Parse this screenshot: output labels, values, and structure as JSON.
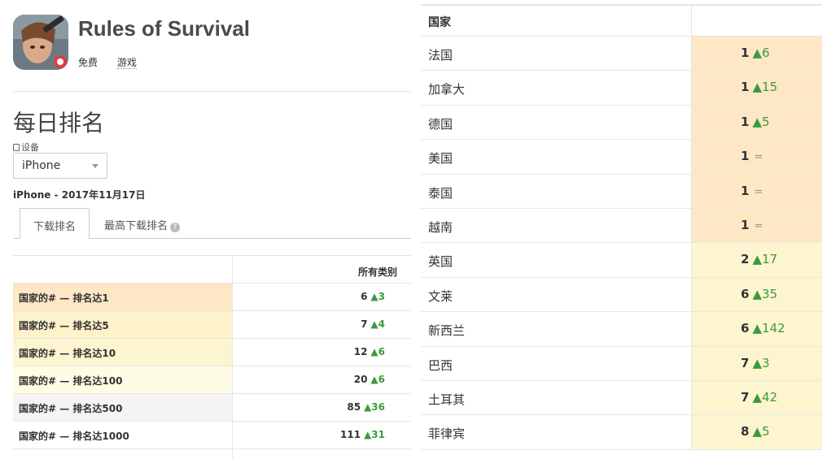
{
  "app": {
    "title": "Rules of Survival",
    "price": "免费",
    "genre": "游戏"
  },
  "section": {
    "title": "每日排名",
    "device_label": "设备",
    "device_selected": "iPhone",
    "device_date": "iPhone - 2017年11月17日"
  },
  "tabs": [
    {
      "label": "下载排名",
      "active": true
    },
    {
      "label": "最高下载排名",
      "active": false
    }
  ],
  "rank_table": {
    "column_header": "所有类别",
    "rows": [
      {
        "label": "国家的# — 排名达1",
        "value": "6",
        "change": "▲3",
        "bg": "#fde7c4"
      },
      {
        "label": "国家的# — 排名达5",
        "value": "7",
        "change": "▲4",
        "bg": "#fdf2c9"
      },
      {
        "label": "国家的# — 排名达10",
        "value": "12",
        "change": "▲6",
        "bg": "#fdf5cf"
      },
      {
        "label": "国家的# — 排名达100",
        "value": "20",
        "change": "▲6",
        "bg": "#fefce4"
      },
      {
        "label": "国家的# — 排名达500",
        "value": "85",
        "change": "▲36",
        "bg": "#f4f4f4"
      },
      {
        "label": "国家的# — 排名达1000",
        "value": "111",
        "change": "▲31",
        "bg": "#ffffff"
      }
    ]
  },
  "country_table": {
    "header_country": "国家",
    "rows": [
      {
        "country": "法国",
        "rank": "1",
        "change": "▲6",
        "bg": "#fde7c4"
      },
      {
        "country": "加拿大",
        "rank": "1",
        "change": "▲15",
        "bg": "#fde7c4"
      },
      {
        "country": "德国",
        "rank": "1",
        "change": "▲5",
        "bg": "#fde7c4"
      },
      {
        "country": "美国",
        "rank": "1",
        "change": "=",
        "bg": "#fde7c4"
      },
      {
        "country": "泰国",
        "rank": "1",
        "change": "=",
        "bg": "#fde7c4"
      },
      {
        "country": "越南",
        "rank": "1",
        "change": "=",
        "bg": "#fde7c4"
      },
      {
        "country": "英国",
        "rank": "2",
        "change": "▲17",
        "bg": "#fdf5cf"
      },
      {
        "country": "文莱",
        "rank": "6",
        "change": "▲35",
        "bg": "#fdf5cf"
      },
      {
        "country": "新西兰",
        "rank": "6",
        "change": "▲142",
        "bg": "#fdf5cf"
      },
      {
        "country": "巴西",
        "rank": "7",
        "change": "▲3",
        "bg": "#fdf5cf"
      },
      {
        "country": "土耳其",
        "rank": "7",
        "change": "▲42",
        "bg": "#fdf5cf"
      },
      {
        "country": "菲律宾",
        "rank": "8",
        "change": "▲5",
        "bg": "#fdf5cf"
      }
    ]
  },
  "colors": {
    "positive_change": "#3d9a3d",
    "top_rank_bg": "#fde7c4",
    "secondary_rank_bg": "#fdf5cf"
  }
}
